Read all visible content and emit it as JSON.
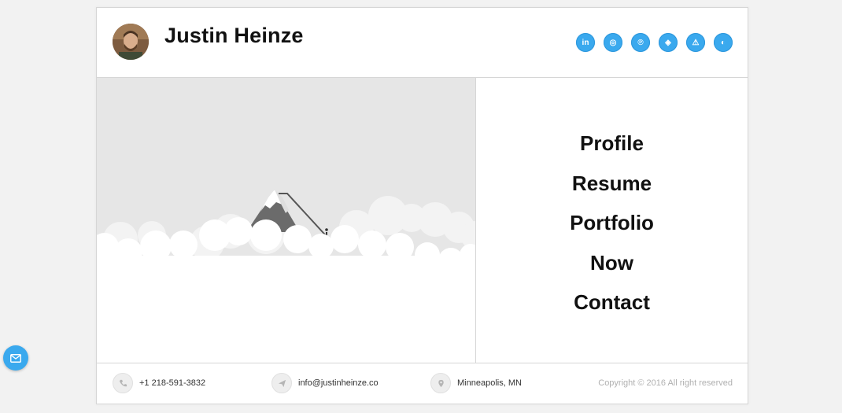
{
  "header": {
    "name": "Justin Heinze",
    "socials": [
      {
        "icon": "linkedin-icon",
        "glyph": "in"
      },
      {
        "icon": "instagram-icon",
        "glyph": "◎"
      },
      {
        "icon": "pinterest-icon",
        "glyph": "℗"
      },
      {
        "icon": "codepen-icon",
        "glyph": "◈"
      },
      {
        "icon": "strava-icon",
        "glyph": "⚠"
      },
      {
        "icon": "github-icon",
        "glyph": "◐"
      }
    ]
  },
  "menu": {
    "items": [
      "Profile",
      "Resume",
      "Portfolio",
      "Now",
      "Contact"
    ]
  },
  "footer": {
    "phone": "+1 218-591-3832",
    "email": "info@justinheinze.co",
    "location": "Minneapolis, MN",
    "copyright": "Copyright © 2016 All right reserved"
  },
  "colors": {
    "accent": "#3aa9ee",
    "hero_sky": "#e6e6e6",
    "mountain": "#6b6b6b",
    "text": "#111111"
  }
}
